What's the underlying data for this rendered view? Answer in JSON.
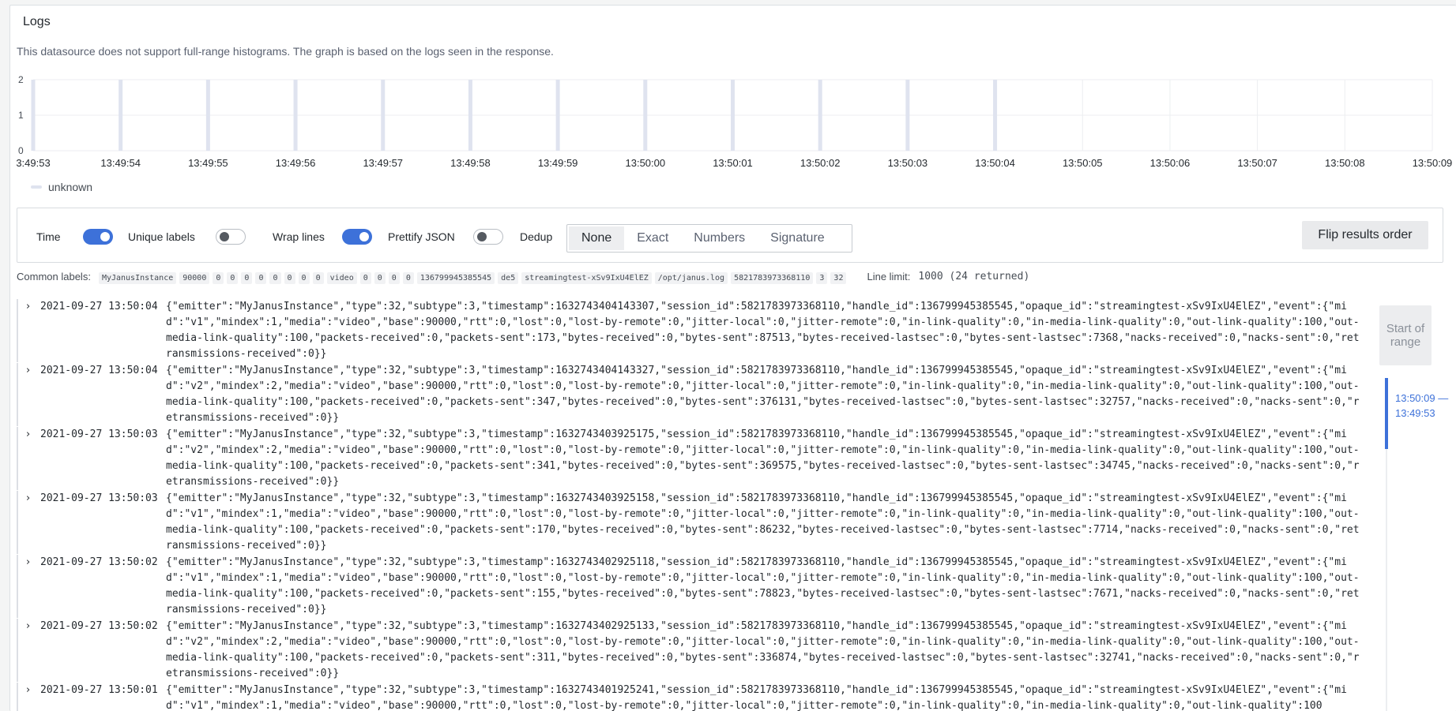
{
  "panel": {
    "title": "Logs",
    "histogram_note": "This datasource does not support full-range histograms. The graph is based on the logs seen in the response."
  },
  "chart_data": {
    "type": "bar",
    "x": [
      "13:49:53",
      "13:49:54",
      "13:49:55",
      "13:49:56",
      "13:49:57",
      "13:49:58",
      "13:49:59",
      "13:50:00",
      "13:50:01",
      "13:50:02",
      "13:50:03",
      "13:50:04"
    ],
    "x_tick_labels": [
      "3:49:53",
      "13:49:54",
      "13:49:55",
      "13:49:56",
      "13:49:57",
      "13:49:58",
      "13:49:59",
      "13:50:00",
      "13:50:01",
      "13:50:02",
      "13:50:03",
      "13:50:04",
      "13:50:05",
      "13:50:06",
      "13:50:07",
      "13:50:08",
      "13:50:09"
    ],
    "series": [
      {
        "name": "unknown",
        "values": [
          2,
          2,
          2,
          2,
          2,
          2,
          2,
          2,
          2,
          2,
          2,
          2
        ]
      }
    ],
    "y_tick_labels": [
      "0",
      "1",
      "2"
    ],
    "ylim": [
      0,
      2
    ],
    "grid": true,
    "legend": "bottom-left",
    "color": "#dfe3ef"
  },
  "options": {
    "time": {
      "label": "Time",
      "on": true
    },
    "unique_labels": {
      "label": "Unique labels",
      "on": false
    },
    "wrap_lines": {
      "label": "Wrap lines",
      "on": true
    },
    "prettify_json": {
      "label": "Prettify JSON",
      "on": false
    },
    "dedup": {
      "label": "Dedup",
      "choices": [
        "None",
        "Exact",
        "Numbers",
        "Signature"
      ],
      "selected": "None"
    },
    "flip_label": "Flip results order"
  },
  "meta": {
    "common_labels_key": "Common labels:",
    "common_labels": [
      "MyJanusInstance",
      "90000",
      "0",
      "0",
      "0",
      "0",
      "0",
      "0",
      "0",
      "0",
      "video",
      "0",
      "0",
      "0",
      "0",
      "136799945385545",
      "de5",
      "streamingtest-xSv9IxU4ElEZ",
      "/opt/janus.log",
      "5821783973368110",
      "3",
      "32"
    ],
    "line_limit_key": "Line limit:",
    "line_limit_value": "1000 (24 returned)"
  },
  "logs": [
    {
      "ts": "2021-09-27 13:50:04",
      "msg": "{\"emitter\":\"MyJanusInstance\",\"type\":32,\"subtype\":3,\"timestamp\":1632743404143307,\"session_id\":5821783973368110,\"handle_id\":136799945385545,\"opaque_id\":\"streamingtest-xSv9IxU4ElEZ\",\"event\":{\"mid\":\"v1\",\"mindex\":1,\"media\":\"video\",\"base\":90000,\"rtt\":0,\"lost\":0,\"lost-by-remote\":0,\"jitter-local\":0,\"jitter-remote\":0,\"in-link-quality\":0,\"in-media-link-quality\":0,\"out-link-quality\":100,\"out-media-link-quality\":100,\"packets-received\":0,\"packets-sent\":173,\"bytes-received\":0,\"bytes-sent\":87513,\"bytes-received-lastsec\":0,\"bytes-sent-lastsec\":7368,\"nacks-received\":0,\"nacks-sent\":0,\"retransmissions-received\":0}}"
    },
    {
      "ts": "2021-09-27 13:50:04",
      "msg": "{\"emitter\":\"MyJanusInstance\",\"type\":32,\"subtype\":3,\"timestamp\":1632743404143327,\"session_id\":5821783973368110,\"handle_id\":136799945385545,\"opaque_id\":\"streamingtest-xSv9IxU4ElEZ\",\"event\":{\"mid\":\"v2\",\"mindex\":2,\"media\":\"video\",\"base\":90000,\"rtt\":0,\"lost\":0,\"lost-by-remote\":0,\"jitter-local\":0,\"jitter-remote\":0,\"in-link-quality\":0,\"in-media-link-quality\":0,\"out-link-quality\":100,\"out-media-link-quality\":100,\"packets-received\":0,\"packets-sent\":347,\"bytes-received\":0,\"bytes-sent\":376131,\"bytes-received-lastsec\":0,\"bytes-sent-lastsec\":32757,\"nacks-received\":0,\"nacks-sent\":0,\"retransmissions-received\":0}}"
    },
    {
      "ts": "2021-09-27 13:50:03",
      "msg": "{\"emitter\":\"MyJanusInstance\",\"type\":32,\"subtype\":3,\"timestamp\":1632743403925175,\"session_id\":5821783973368110,\"handle_id\":136799945385545,\"opaque_id\":\"streamingtest-xSv9IxU4ElEZ\",\"event\":{\"mid\":\"v2\",\"mindex\":2,\"media\":\"video\",\"base\":90000,\"rtt\":0,\"lost\":0,\"lost-by-remote\":0,\"jitter-local\":0,\"jitter-remote\":0,\"in-link-quality\":0,\"in-media-link-quality\":0,\"out-link-quality\":100,\"out-media-link-quality\":100,\"packets-received\":0,\"packets-sent\":341,\"bytes-received\":0,\"bytes-sent\":369575,\"bytes-received-lastsec\":0,\"bytes-sent-lastsec\":34745,\"nacks-received\":0,\"nacks-sent\":0,\"retransmissions-received\":0}}"
    },
    {
      "ts": "2021-09-27 13:50:03",
      "msg": "{\"emitter\":\"MyJanusInstance\",\"type\":32,\"subtype\":3,\"timestamp\":1632743403925158,\"session_id\":5821783973368110,\"handle_id\":136799945385545,\"opaque_id\":\"streamingtest-xSv9IxU4ElEZ\",\"event\":{\"mid\":\"v1\",\"mindex\":1,\"media\":\"video\",\"base\":90000,\"rtt\":0,\"lost\":0,\"lost-by-remote\":0,\"jitter-local\":0,\"jitter-remote\":0,\"in-link-quality\":0,\"in-media-link-quality\":0,\"out-link-quality\":100,\"out-media-link-quality\":100,\"packets-received\":0,\"packets-sent\":170,\"bytes-received\":0,\"bytes-sent\":86232,\"bytes-received-lastsec\":0,\"bytes-sent-lastsec\":7714,\"nacks-received\":0,\"nacks-sent\":0,\"retransmissions-received\":0}}"
    },
    {
      "ts": "2021-09-27 13:50:02",
      "msg": "{\"emitter\":\"MyJanusInstance\",\"type\":32,\"subtype\":3,\"timestamp\":1632743402925118,\"session_id\":5821783973368110,\"handle_id\":136799945385545,\"opaque_id\":\"streamingtest-xSv9IxU4ElEZ\",\"event\":{\"mid\":\"v1\",\"mindex\":1,\"media\":\"video\",\"base\":90000,\"rtt\":0,\"lost\":0,\"lost-by-remote\":0,\"jitter-local\":0,\"jitter-remote\":0,\"in-link-quality\":0,\"in-media-link-quality\":0,\"out-link-quality\":100,\"out-media-link-quality\":100,\"packets-received\":0,\"packets-sent\":155,\"bytes-received\":0,\"bytes-sent\":78823,\"bytes-received-lastsec\":0,\"bytes-sent-lastsec\":7671,\"nacks-received\":0,\"nacks-sent\":0,\"retransmissions-received\":0}}"
    },
    {
      "ts": "2021-09-27 13:50:02",
      "msg": "{\"emitter\":\"MyJanusInstance\",\"type\":32,\"subtype\":3,\"timestamp\":1632743402925133,\"session_id\":5821783973368110,\"handle_id\":136799945385545,\"opaque_id\":\"streamingtest-xSv9IxU4ElEZ\",\"event\":{\"mid\":\"v2\",\"mindex\":2,\"media\":\"video\",\"base\":90000,\"rtt\":0,\"lost\":0,\"lost-by-remote\":0,\"jitter-local\":0,\"jitter-remote\":0,\"in-link-quality\":0,\"in-media-link-quality\":0,\"out-link-quality\":100,\"out-media-link-quality\":100,\"packets-received\":0,\"packets-sent\":311,\"bytes-received\":0,\"bytes-sent\":336874,\"bytes-received-lastsec\":0,\"bytes-sent-lastsec\":32741,\"nacks-received\":0,\"nacks-sent\":0,\"retransmissions-received\":0}}"
    },
    {
      "ts": "2021-09-27 13:50:01",
      "msg": "{\"emitter\":\"MyJanusInstance\",\"type\":32,\"subtype\":3,\"timestamp\":1632743401925241,\"session_id\":5821783973368110,\"handle_id\":136799945385545,\"opaque_id\":\"streamingtest-xSv9IxU4ElEZ\",\"event\":{\"mid\":\"v1\",\"mindex\":1,\"media\":\"video\",\"base\":90000,\"rtt\":0,\"lost\":0,\"lost-by-remote\":0,\"jitter-local\":0,\"jitter-remote\":0,\"in-link-quality\":0,\"in-media-link-quality\":0,\"out-link-quality\":100"
    }
  ],
  "range": {
    "start_label": "Start of range",
    "current_range": "13:50:09 — 13:49:53"
  },
  "colors": {
    "accent": "#3d71d9",
    "bar": "#dfe3ef",
    "border": "#d8dce0"
  }
}
